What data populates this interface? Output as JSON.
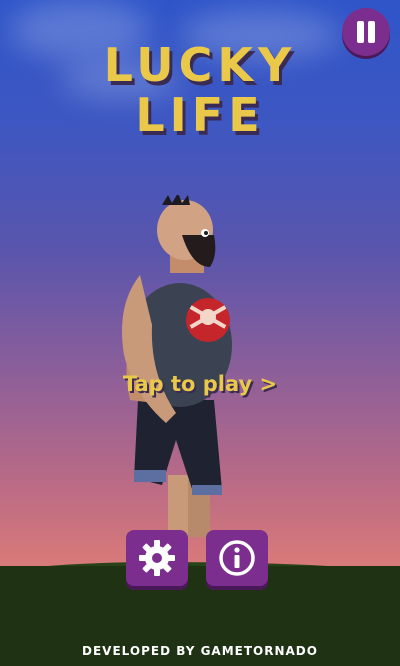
{
  "game": {
    "title_line1": "LUCKY",
    "title_line2": "LIFE",
    "prompt": "Tap to play >",
    "footer": "DEVELOPED BY GAMETORNADO"
  },
  "buttons": {
    "pause": "pause-icon",
    "settings": "gear-icon",
    "info": "info-icon"
  },
  "colors": {
    "title": "#e9c84a",
    "button": "#7b2e8e",
    "ground": "#1f3314"
  }
}
